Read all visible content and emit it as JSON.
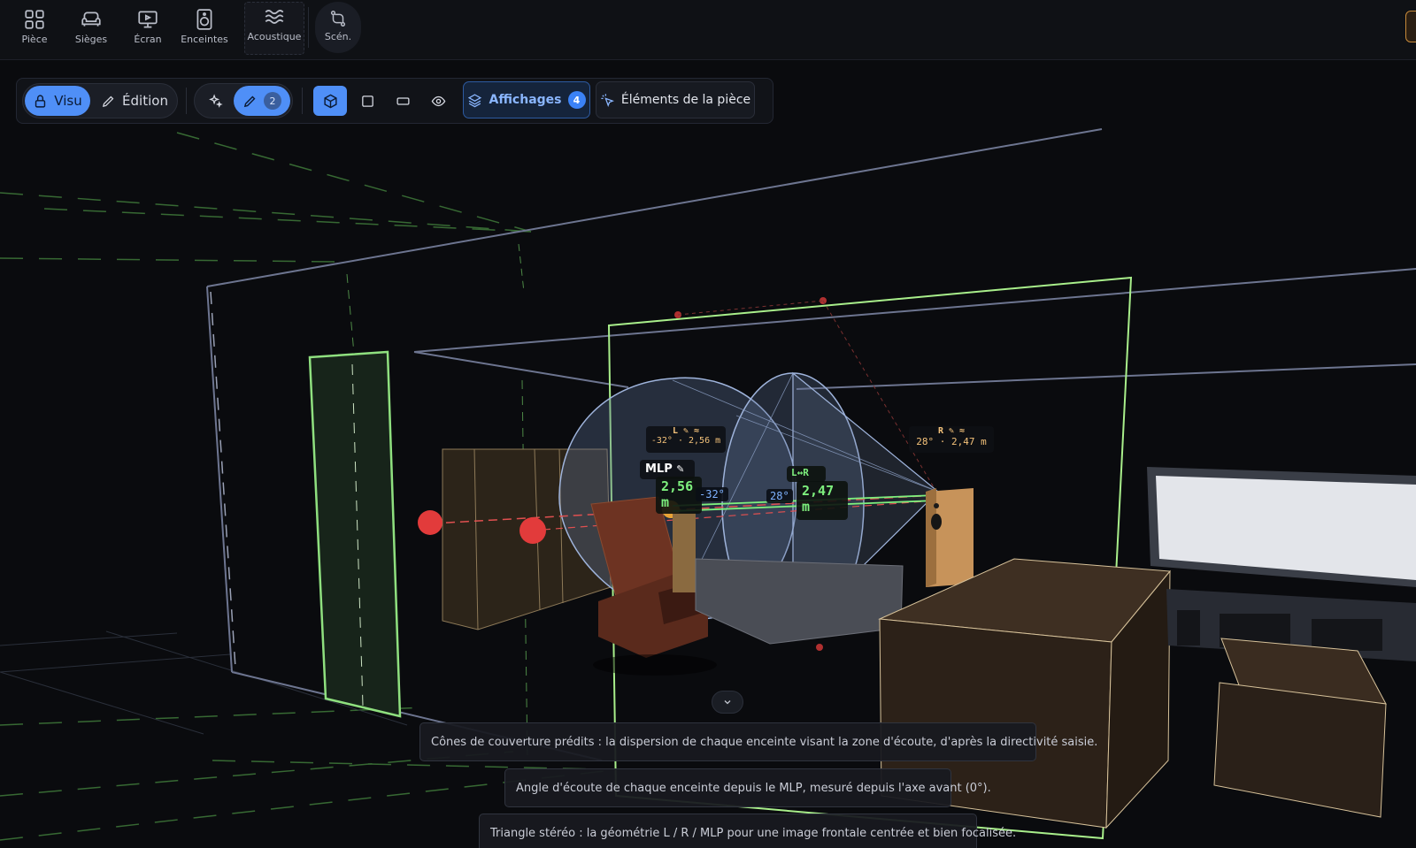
{
  "nav": {
    "tabs": [
      {
        "label": "Pièce",
        "icon": "grid-icon"
      },
      {
        "label": "Sièges",
        "icon": "sofa-icon"
      },
      {
        "label": "Écran",
        "icon": "screen-icon"
      },
      {
        "label": "Enceintes",
        "icon": "speaker-icon"
      },
      {
        "label": "Acoustique",
        "icon": "waves-icon"
      },
      {
        "label": "Scén.",
        "icon": "swap-icon"
      }
    ]
  },
  "toolbar": {
    "visu_label": "Visu",
    "edition_label": "Édition",
    "edit_count": "2",
    "affichages_label": "Affichages",
    "affichages_count": "4",
    "elements_label": "Éléments de la pièce"
  },
  "scene": {
    "speaker_l": {
      "title": "L ✎ ≈",
      "detail": "-32° · 2,56 m"
    },
    "speaker_r": {
      "title": "R ✎ ≈",
      "detail": "28° · 2,47 m"
    },
    "mlp_label": "MLP",
    "mlp_pen": "✎",
    "dist_l_value": "2,56",
    "dist_l_unit": "m",
    "dist_r_value": "2,47",
    "dist_r_unit": "m",
    "lr_label": "L↔R",
    "angle_l": "-32°",
    "angle_r": "28°"
  },
  "tooltips": {
    "cones": "Cônes de couverture prédits : la dispersion de chaque enceinte visant la zone d'écoute, d'après la directivité saisie.",
    "angle": "Angle d'écoute de chaque enceinte depuis le MLP, mesuré depuis l'axe avant (0°).",
    "triangle": "Triangle stéréo : la géométrie L / R / MLP pour une image frontale centrée et bien focalisée."
  },
  "colors": {
    "accent": "#4f8ff7",
    "distance_green": "#7ef07e",
    "label_orange": "#f4c27a",
    "angle_blue": "#7fb2ff",
    "speaker_red": "#e23b3b"
  }
}
